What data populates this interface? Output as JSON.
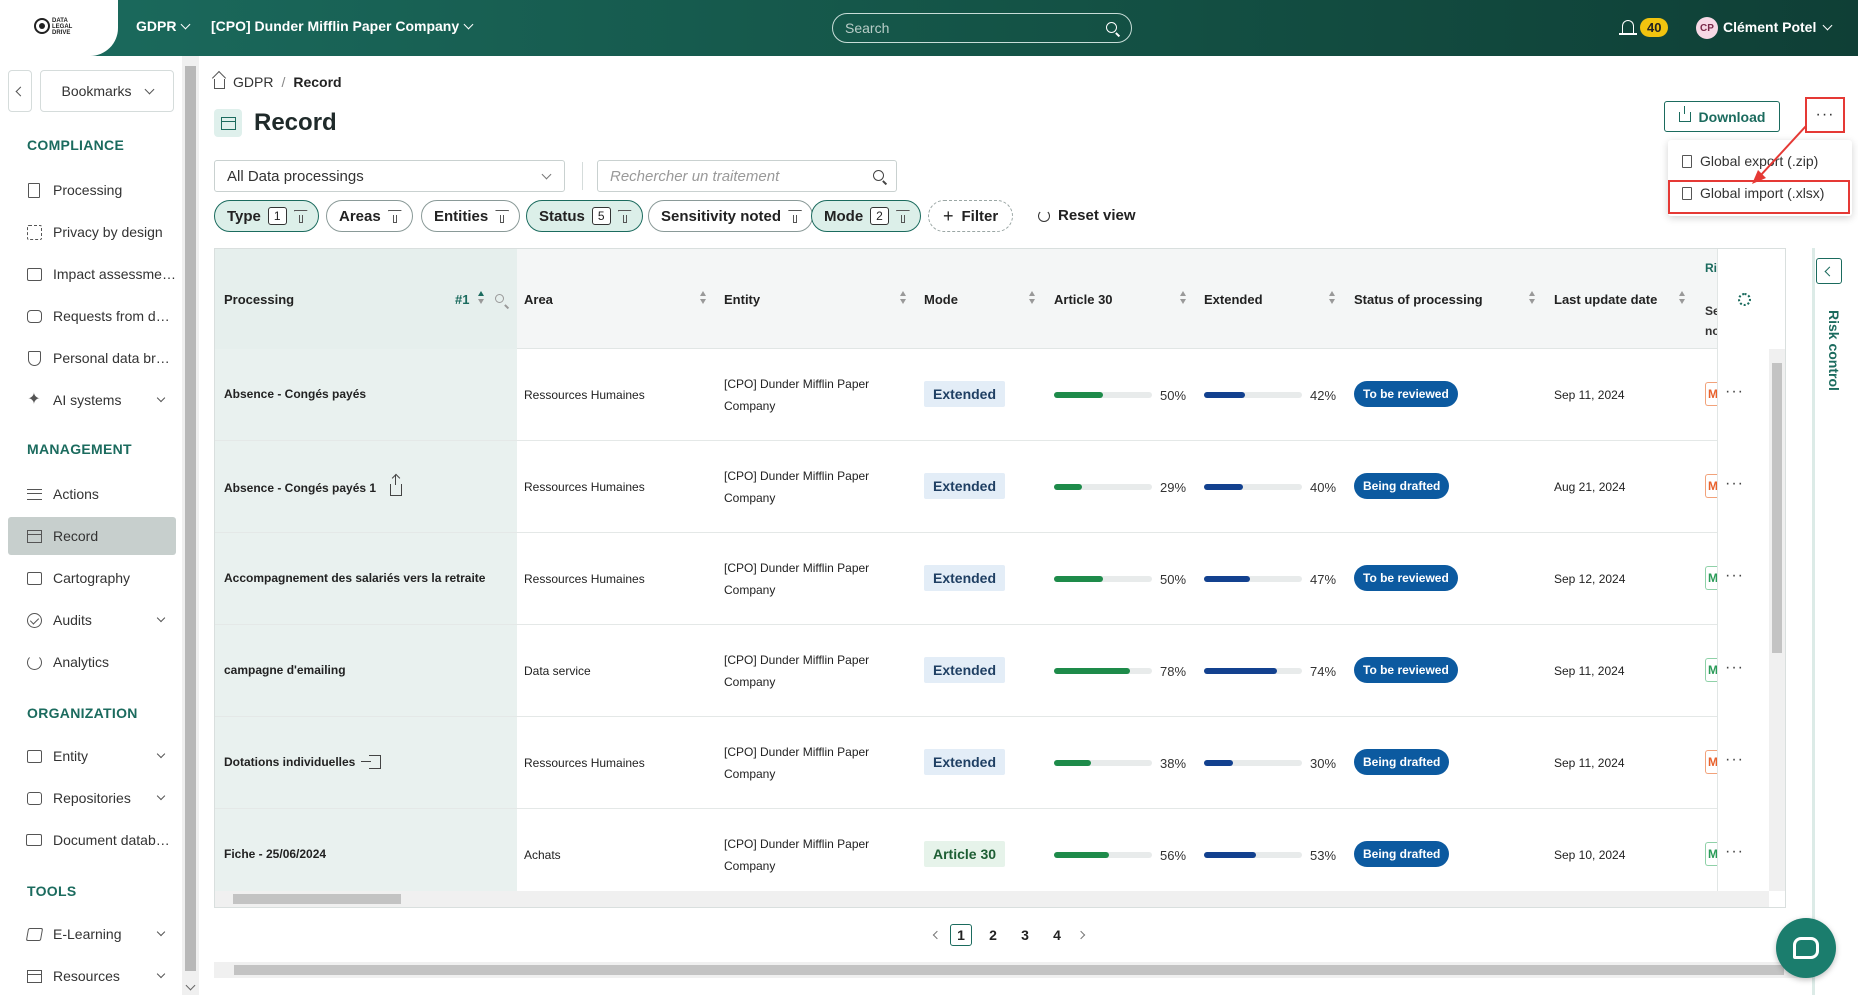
{
  "topbar": {
    "logo_text": "DATA LEGAL DRIVE",
    "module": "GDPR",
    "company": "[CPO] Dunder Mifflin Paper Company",
    "search_placeholder": "Search",
    "notifications": "40",
    "user_initials": "CP",
    "user_name": "Clément Potel"
  },
  "sidebar": {
    "bookmarks": "Bookmarks",
    "sections": {
      "compliance": "COMPLIANCE",
      "management": "MANAGEMENT",
      "organization": "ORGANIZATION",
      "tools": "TOOLS"
    },
    "items": {
      "processing": "Processing",
      "privacy": "Privacy by design",
      "impact": "Impact assessments",
      "requests": "Requests from data subjects",
      "breach": "Personal data breaches",
      "ai": "AI systems",
      "actions": "Actions",
      "record": "Record",
      "cartography": "Cartography",
      "audits": "Audits",
      "analytics": "Analytics",
      "entity": "Entity",
      "repositories": "Repositories",
      "document": "Document database",
      "elearning": "E-Learning",
      "resources": "Resources"
    }
  },
  "breadcrumb": {
    "root": "GDPR",
    "sep": "/",
    "current": "Record"
  },
  "page": {
    "title": "Record"
  },
  "actions": {
    "download": "Download",
    "more": "···",
    "menu": {
      "export": "Global export (.zip)",
      "import": "Global import (.xlsx)"
    }
  },
  "filters": {
    "select_value": "All Data processings",
    "search_placeholder": "Rechercher un traitement",
    "chips": {
      "type": "Type",
      "type_count": "1",
      "areas": "Areas",
      "entities": "Entities",
      "status": "Status",
      "status_count": "5",
      "sensitivity": "Sensitivity noted",
      "mode": "Mode",
      "mode_count": "2"
    },
    "add_filter": "Filter",
    "reset": "Reset view"
  },
  "table": {
    "headers": {
      "processing": "Processing",
      "sort_index": "#1",
      "area": "Area",
      "entity": "Entity",
      "mode": "Mode",
      "article30": "Article 30",
      "extended": "Extended",
      "status": "Status of processing",
      "last_update": "Last update date",
      "risk": "Risk",
      "sensitivity": "Sensitivity noted"
    },
    "rows": [
      {
        "name": "Absence - Congés payés",
        "area": "Ressources Humaines",
        "entity": "[CPO] Dunder Mifflin Paper Company",
        "mode": "Extended",
        "a30": 50,
        "a30_label": "50%",
        "ext": 42,
        "ext_label": "42%",
        "status": "To be reviewed",
        "date": "Sep 11, 2024",
        "risk": "M",
        "risk_level": "medium",
        "more": "···"
      },
      {
        "name": "Absence - Congés payés 1",
        "area": "Ressources Humaines",
        "entity": "[CPO] Dunder Mifflin Paper Company",
        "mode": "Extended",
        "a30": 29,
        "a30_label": "29%",
        "ext": 40,
        "ext_label": "40%",
        "status": "Being drafted",
        "date": "Aug 21, 2024",
        "risk": "M",
        "risk_level": "medium",
        "more": "···"
      },
      {
        "name": "Accompagnement des salariés vers la retraite",
        "area": "Ressources Humaines",
        "entity": "[CPO] Dunder Mifflin Paper Company",
        "mode": "Extended",
        "a30": 50,
        "a30_label": "50%",
        "ext": 47,
        "ext_label": "47%",
        "status": "To be reviewed",
        "date": "Sep 12, 2024",
        "risk": "M",
        "risk_level": "low",
        "more": "···"
      },
      {
        "name": "campagne d'emailing",
        "area": "Data service",
        "entity": "[CPO] Dunder Mifflin Paper Company",
        "mode": "Extended",
        "a30": 78,
        "a30_label": "78%",
        "ext": 74,
        "ext_label": "74%",
        "status": "To be reviewed",
        "date": "Sep 11, 2024",
        "risk": "M",
        "risk_level": "low",
        "more": "···"
      },
      {
        "name": "Dotations individuelles",
        "area": "Ressources Humaines",
        "entity": "[CPO] Dunder Mifflin Paper Company",
        "mode": "Extended",
        "a30": 38,
        "a30_label": "38%",
        "ext": 30,
        "ext_label": "30%",
        "status": "Being drafted",
        "date": "Sep 11, 2024",
        "risk": "M",
        "risk_level": "medium",
        "more": "···"
      },
      {
        "name": "Fiche - 25/06/2024",
        "area": "Achats",
        "entity": "[CPO] Dunder Mifflin Paper Company",
        "mode": "Article 30",
        "a30": 56,
        "a30_label": "56%",
        "ext": 53,
        "ext_label": "53%",
        "status": "Being drafted",
        "date": "Sep 10, 2024",
        "risk": "M",
        "risk_level": "low",
        "more": "···"
      }
    ]
  },
  "right_panel": {
    "label": "Risk control"
  },
  "pagination": {
    "pages": [
      "1",
      "2",
      "3",
      "4"
    ],
    "current": "1"
  },
  "colors": {
    "brand": "#1b6b5e",
    "status_blue": "#0c5aa0",
    "highlight_red": "#e53935"
  }
}
